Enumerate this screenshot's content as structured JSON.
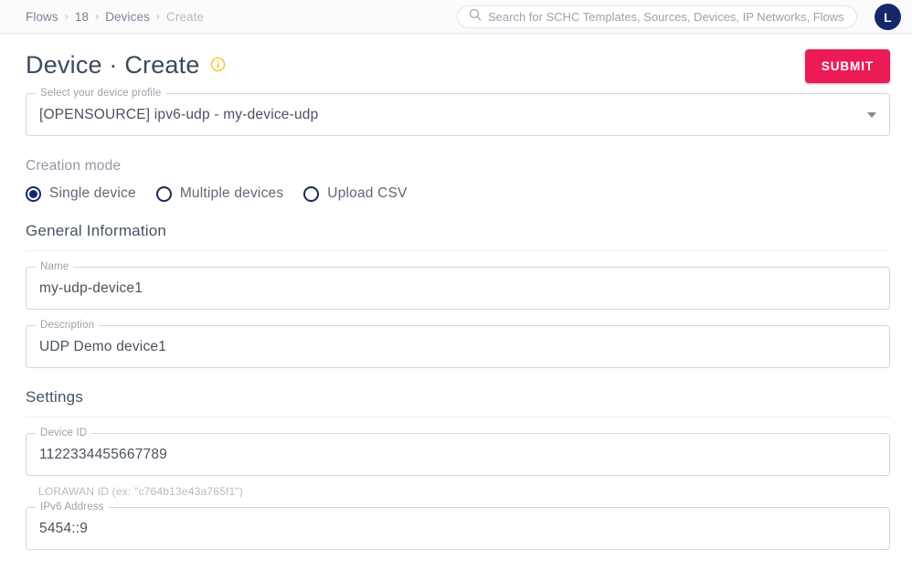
{
  "header": {
    "breadcrumb": [
      {
        "label": "Flows",
        "muted": false
      },
      {
        "label": "18",
        "muted": false
      },
      {
        "label": "Devices",
        "muted": false
      },
      {
        "label": "Create",
        "muted": true
      }
    ],
    "separator": "›",
    "search": {
      "placeholder": "Search for SCHC Templates, Sources, Devices, IP Networks, Flows",
      "value": "",
      "icon": "search-icon"
    },
    "avatar": {
      "initial": "L",
      "color": "#16286b"
    }
  },
  "page": {
    "title": "Device · Create",
    "info_icon": "info-icon",
    "info_color": "#f9c22e",
    "submit_label": "SUBMIT",
    "submit_color": "#eb1b55"
  },
  "profile": {
    "legend": "Select your device profile",
    "value": "[OPENSOURCE] ipv6-udp - my-device-udp",
    "arrow_icon": "chevron-down-icon"
  },
  "creation_mode": {
    "label": "Creation mode",
    "options": [
      {
        "label": "Single device",
        "selected": true
      },
      {
        "label": "Multiple devices",
        "selected": false
      },
      {
        "label": "Upload CSV",
        "selected": false
      }
    ]
  },
  "general_information": {
    "title": "General Information",
    "name": {
      "legend": "Name",
      "value": "my-udp-device1",
      "placeholder": "Name"
    },
    "description": {
      "legend": "Description",
      "value": "UDP Demo device1",
      "placeholder": "Description"
    }
  },
  "settings": {
    "title": "Settings",
    "device_id": {
      "legend": "Device ID",
      "value": "1122334455667789",
      "placeholder": "Device ID"
    },
    "device_id_hint": "LORAWAN ID (ex: \"c764b13e43a765f1\")",
    "ipv6_address": {
      "legend": "IPv6 Address",
      "value": "5454::9",
      "placeholder": "IPv6 Address"
    }
  }
}
